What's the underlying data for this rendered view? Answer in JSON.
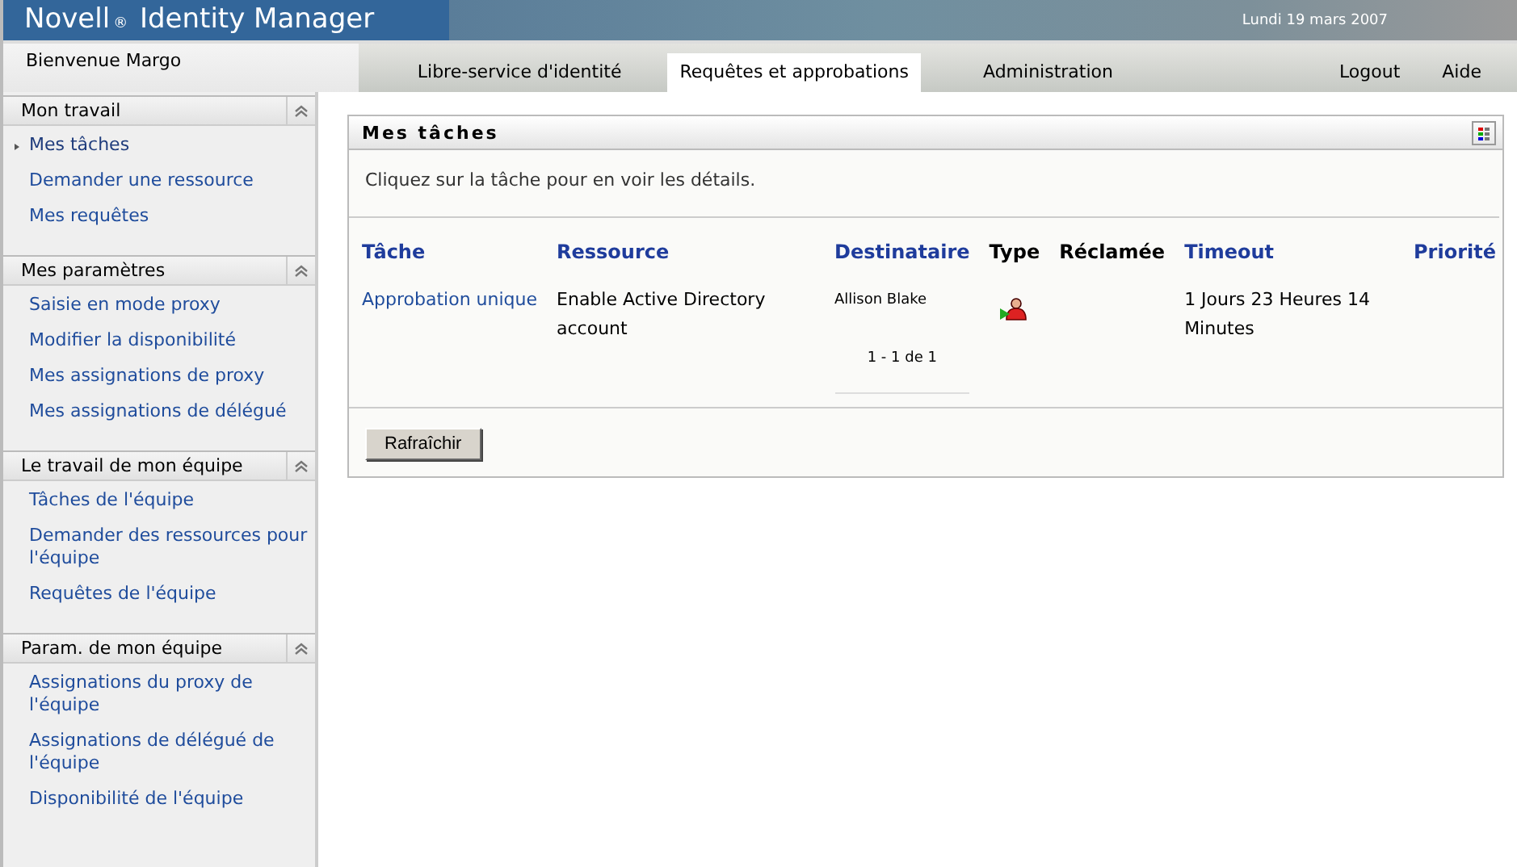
{
  "header": {
    "product": "Novell",
    "product_mark": "®",
    "title": "Identity Manager",
    "date": "Lundi 19 mars 2007"
  },
  "nav": {
    "welcome": "Bienvenue Margo",
    "tabs": [
      {
        "label": "Libre-service d'identité",
        "selected": false
      },
      {
        "label": "Requêtes et approbations",
        "selected": true
      },
      {
        "label": "Administration",
        "selected": false
      }
    ],
    "links": [
      "Logout",
      "Aide"
    ]
  },
  "sidebar": {
    "sections": [
      {
        "title": "Mon travail",
        "items": [
          {
            "label": "Mes tâches",
            "selected": true
          },
          {
            "label": "Demander une ressource",
            "selected": false
          },
          {
            "label": "Mes requêtes",
            "selected": false
          }
        ]
      },
      {
        "title": "Mes paramètres",
        "items": [
          {
            "label": "Saisie en mode proxy",
            "selected": false
          },
          {
            "label": "Modifier la disponibilité",
            "selected": false
          },
          {
            "label": "Mes assignations de proxy",
            "selected": false
          },
          {
            "label": "Mes assignations de délégué",
            "selected": false
          }
        ]
      },
      {
        "title": "Le travail de mon équipe",
        "items": [
          {
            "label": "Tâches de l'équipe",
            "selected": false
          },
          {
            "label": "Demander des ressources pour l'équipe",
            "selected": false
          },
          {
            "label": "Requêtes de l'équipe",
            "selected": false
          }
        ]
      },
      {
        "title": "Param. de mon équipe",
        "items": [
          {
            "label": "Assignations du proxy de l'équipe",
            "selected": false
          },
          {
            "label": "Assignations de délégué de l'équipe",
            "selected": false
          },
          {
            "label": "Disponibilité de l'équipe",
            "selected": false
          }
        ]
      }
    ]
  },
  "panel": {
    "title": "Mes tâches",
    "instruction": "Cliquez sur la tâche pour en voir les détails.",
    "table": {
      "columns": [
        {
          "label": "Tâche",
          "sortable": true
        },
        {
          "label": "Ressource",
          "sortable": true
        },
        {
          "label": "Destinataire",
          "sortable": true
        },
        {
          "label": "Type",
          "sortable": false
        },
        {
          "label": "Réclamée",
          "sortable": false
        },
        {
          "label": "Timeout",
          "sortable": true
        },
        {
          "label": "Priorité",
          "sortable": true
        }
      ],
      "rows": [
        {
          "task": "Approbation unique",
          "resource": "Enable Active Directory account",
          "recipient": "Allison Blake",
          "timeout": "1 Jours 23 Heures 14 Minutes"
        }
      ]
    },
    "pagination": "1 - 1 de 1",
    "button": "Rafraîchir"
  }
}
